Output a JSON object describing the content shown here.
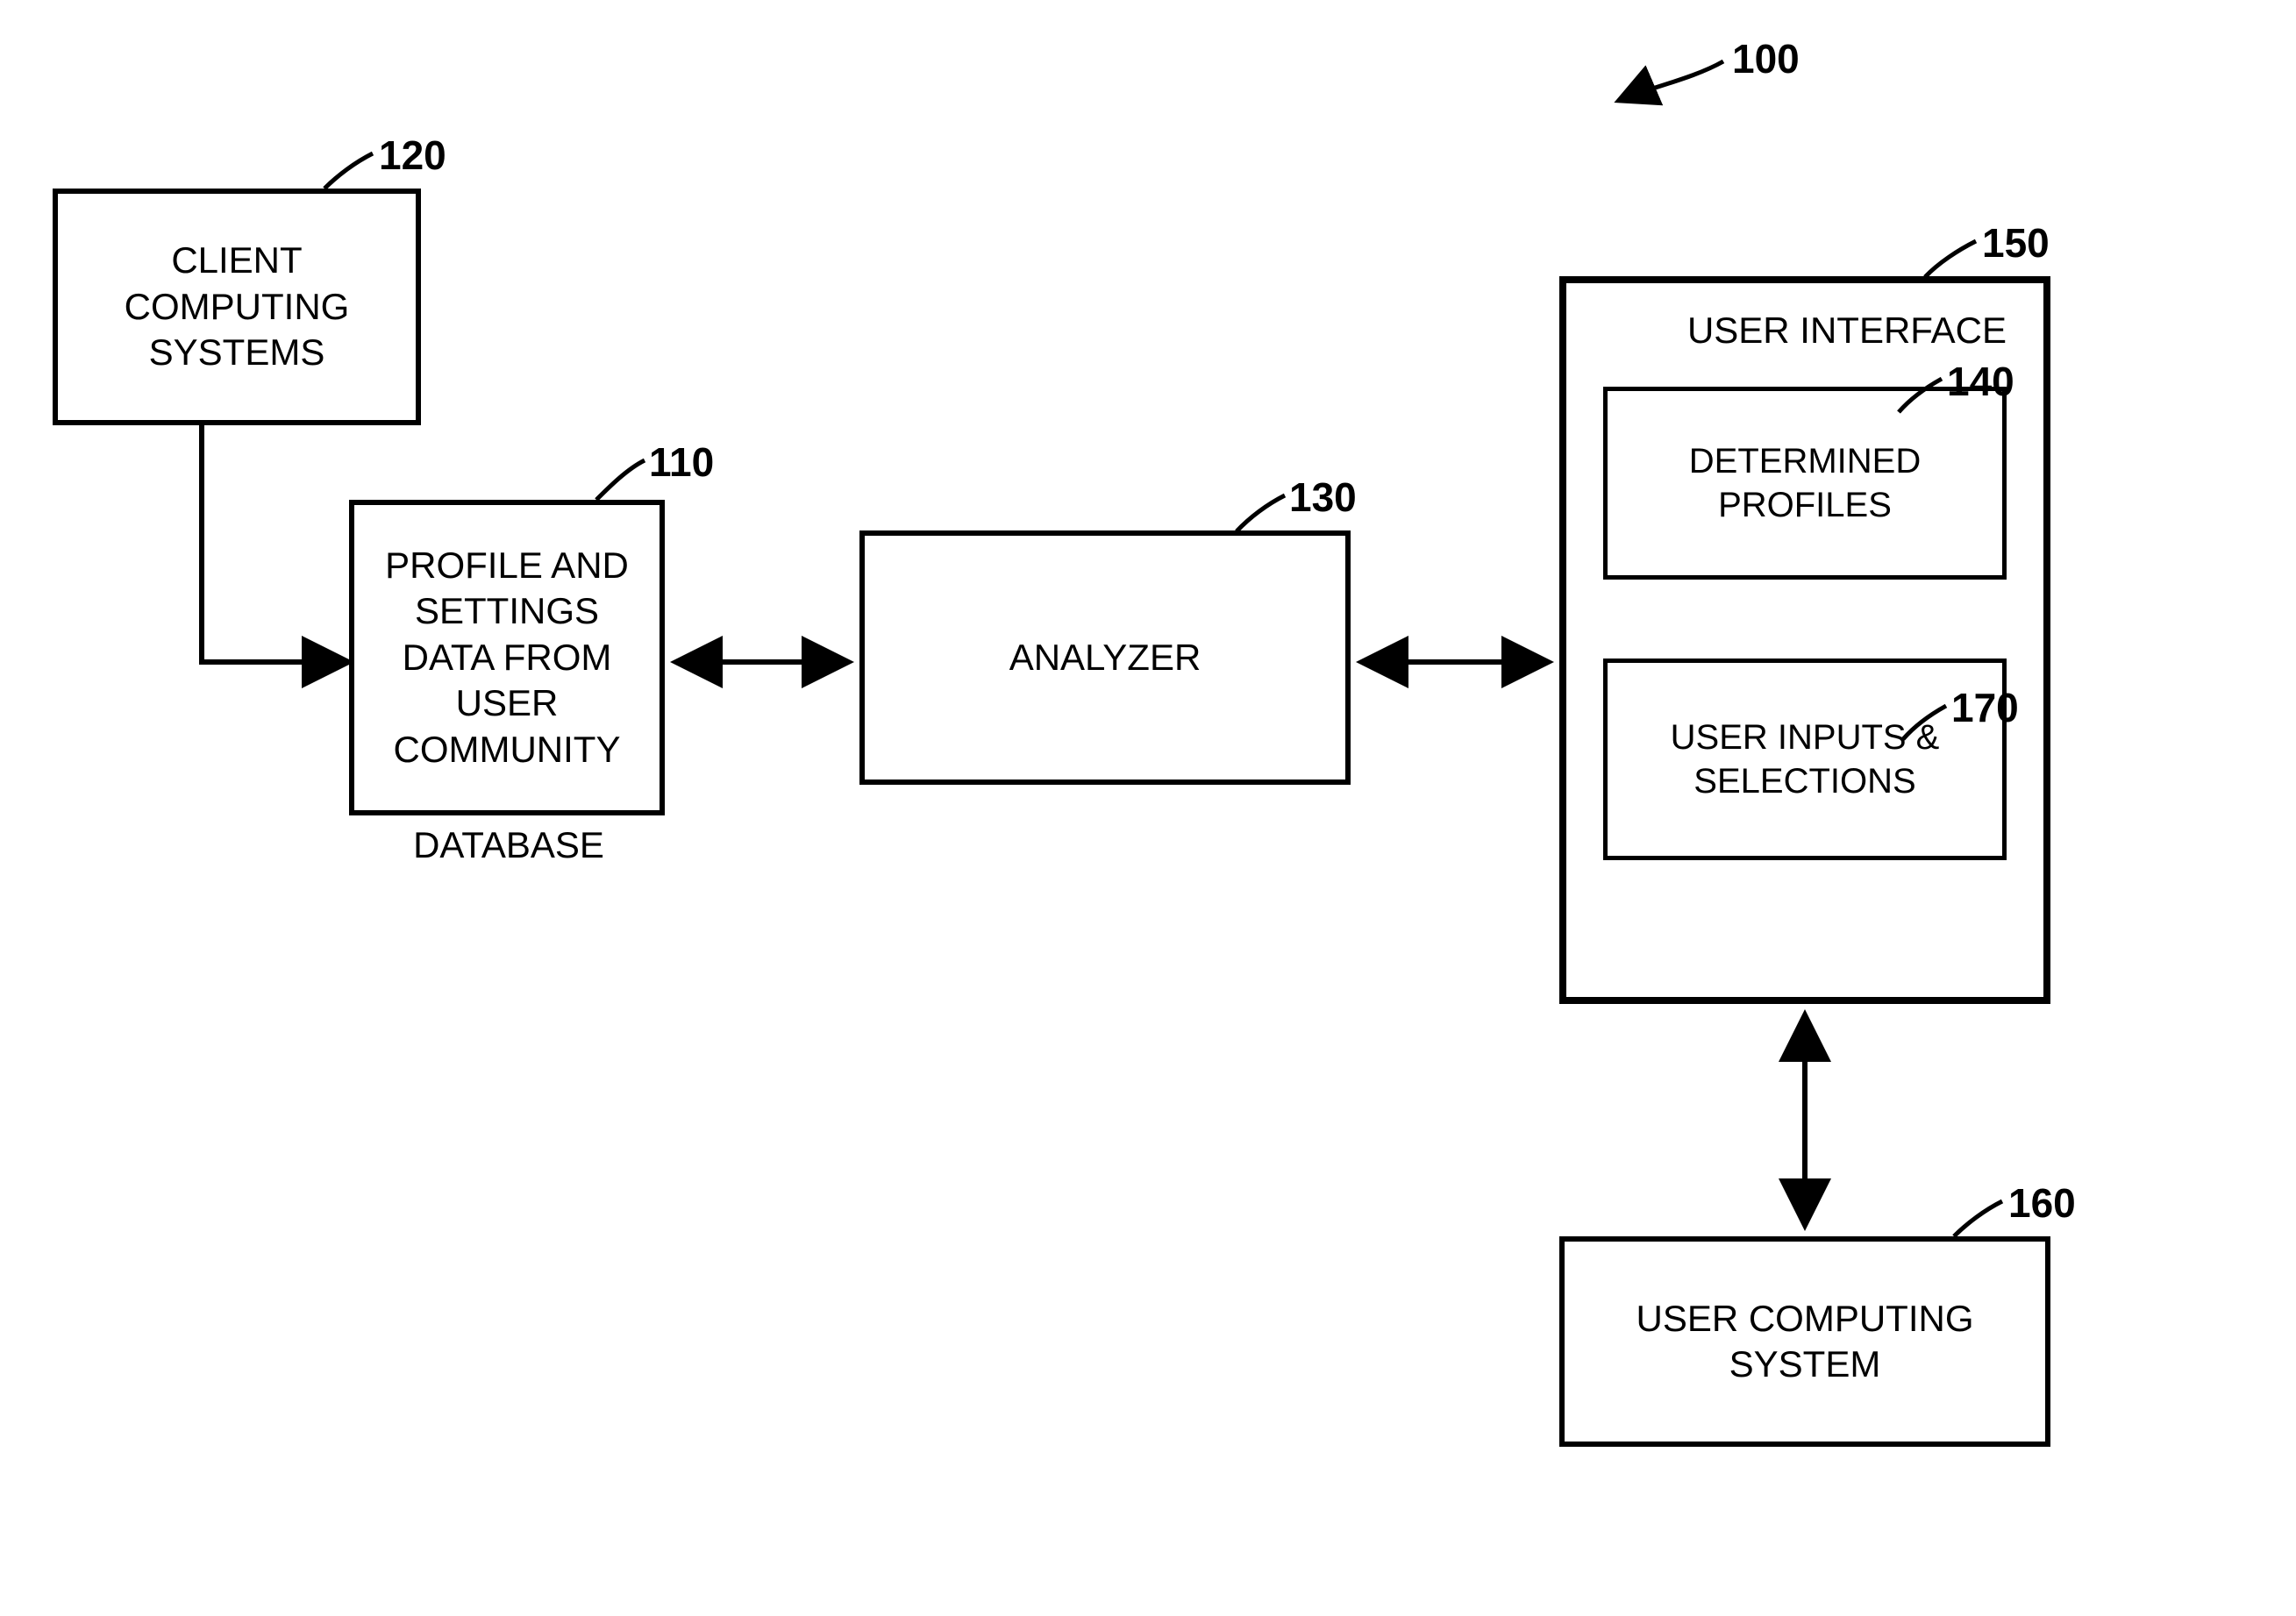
{
  "refs": {
    "system": "100",
    "client": "120",
    "database": "110",
    "analyzer": "130",
    "ui": "150",
    "profiles": "140",
    "inputs": "170",
    "usercomp": "160"
  },
  "boxes": {
    "client": "CLIENT\nCOMPUTING\nSYSTEMS",
    "database": "PROFILE AND\nSETTINGS\nDATA FROM\nUSER\nCOMMUNITY",
    "database_label": "DATABASE",
    "analyzer": "ANALYZER",
    "ui_title": "USER INTERFACE",
    "profiles": "DETERMINED\nPROFILES",
    "inputs": "USER INPUTS &\nSELECTIONS",
    "usercomp": "USER COMPUTING\nSYSTEM"
  }
}
